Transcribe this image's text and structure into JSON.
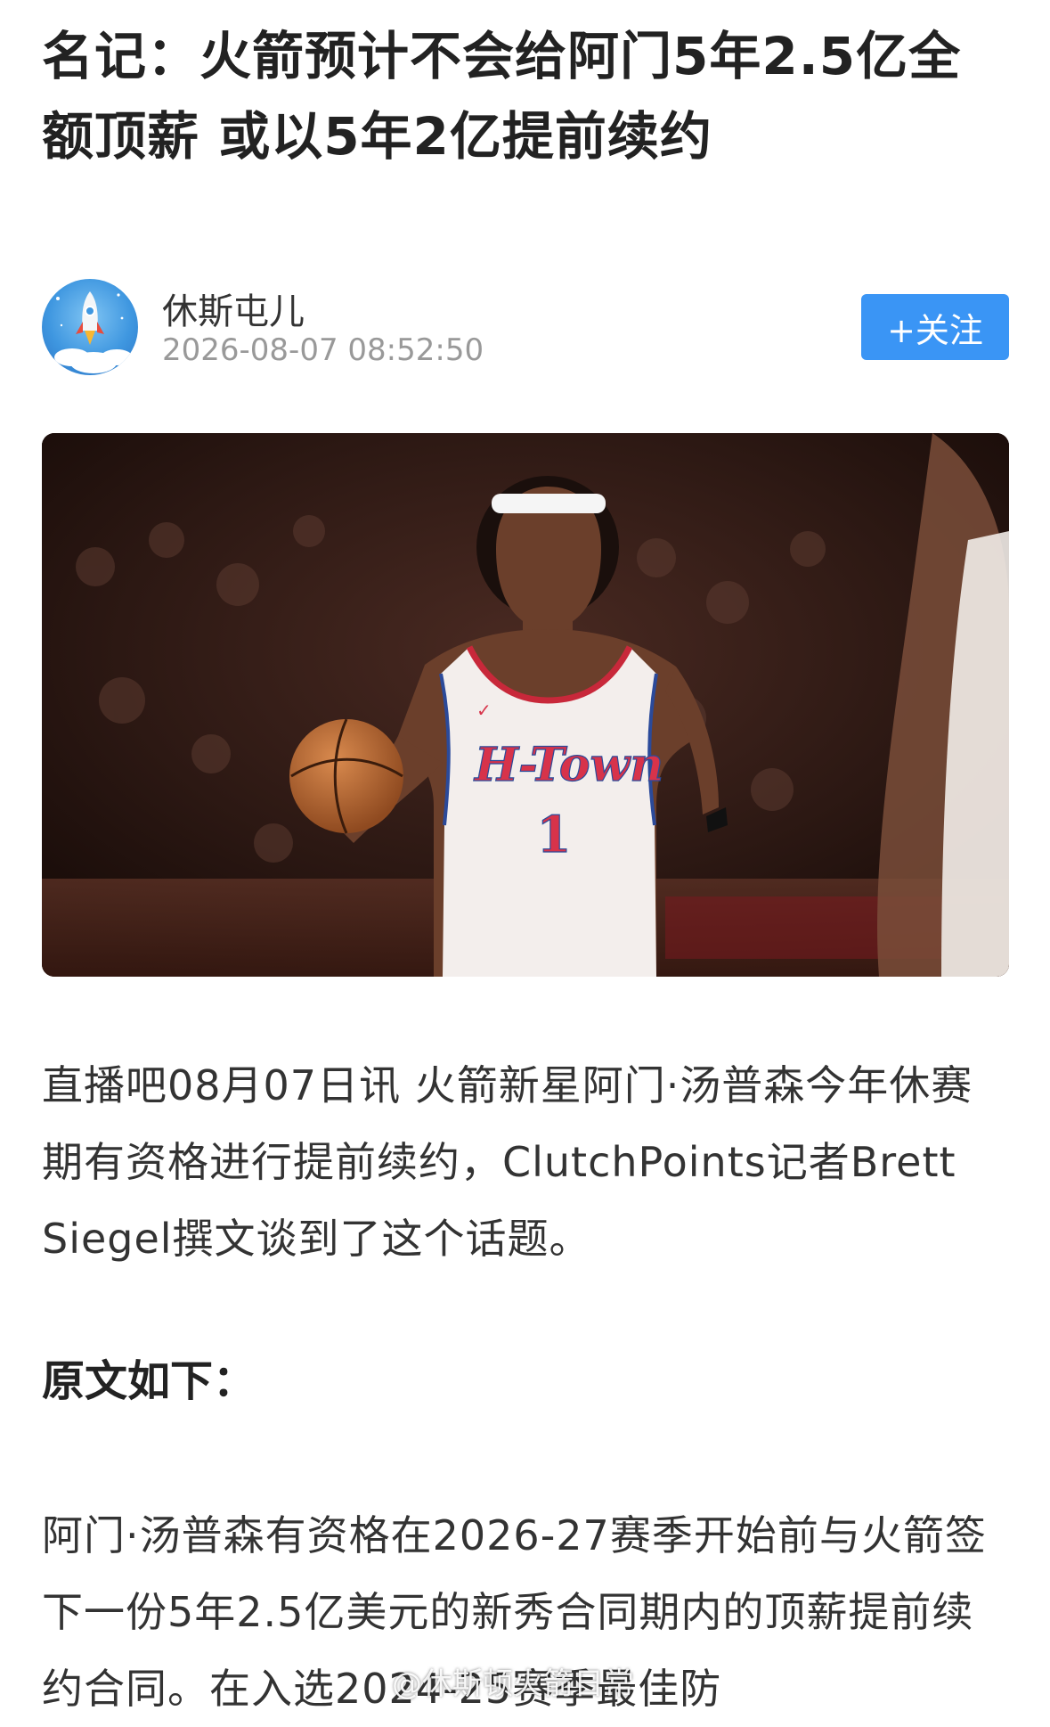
{
  "article": {
    "title": "名记：火箭预计不会给阿门5年2.5亿全额顶薪 或以5年2亿提前续约"
  },
  "author": {
    "name": "休斯屯儿",
    "time": "2026-08-07 08:52:50",
    "follow_label": "+关注",
    "avatar_icon": "rocket-avatar-icon"
  },
  "hero_image": {
    "jersey_text": "H-Town",
    "jersey_number": "1"
  },
  "body": {
    "para1": "直播吧08月07日讯 火箭新星阿门·汤普森今年休赛期有资格进行提前续约，ClutchPoints记者Brett Siegel撰文谈到了这个话题。",
    "subheading": "原文如下：",
    "para2": "阿门·汤普森有资格在2026-27赛季开始前与火箭签下一份5年2.5亿美元的新秀合同期内的顶薪提前续约合同。在入选2024-25赛季最佳防"
  },
  "watermark": "@休斯顿火箭日常",
  "colors": {
    "follow_button": "#3a95f5",
    "time_text": "#999999",
    "title_text": "#222222"
  }
}
